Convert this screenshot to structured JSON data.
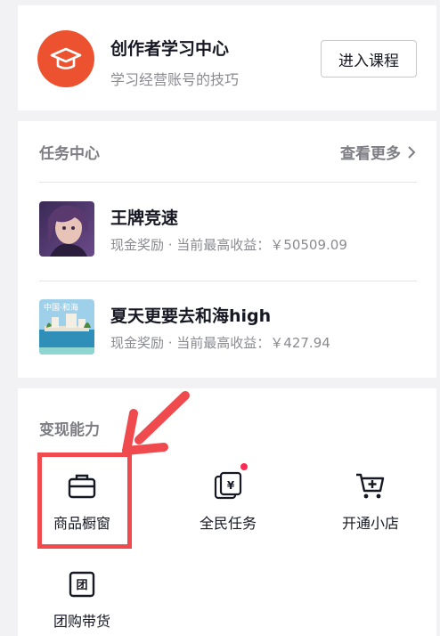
{
  "creator": {
    "title": "创作者学习中心",
    "subtitle": "学习经营账号的技巧",
    "button_label": "进入课程",
    "icon": "graduation-cap-icon",
    "accent": "#ec5230"
  },
  "tasks": {
    "title": "任务中心",
    "more_label": "查看更多",
    "items": [
      {
        "name": "王牌竞速",
        "desc": "现金奖励 · 当前最高收益：￥50509.09",
        "thumb": "game-portrait-thumbnail"
      },
      {
        "name": "夏天更要去和海high",
        "desc": "现金奖励 · 当前最高收益：￥427.94",
        "thumb": "seaside-thumbnail",
        "thumb_text": "中国·和海"
      }
    ]
  },
  "monetization": {
    "title": "变现能力",
    "features": [
      {
        "label": "商品橱窗",
        "icon": "shopping-bag-icon",
        "badge": false
      },
      {
        "label": "全民任务",
        "icon": "yen-coupon-icon",
        "badge": true
      },
      {
        "label": "开通小店",
        "icon": "cart-plus-icon",
        "badge": false
      },
      {
        "label": "团购带货",
        "icon": "group-buy-icon",
        "badge": false
      }
    ]
  },
  "annotation": {
    "color": "#ef4b4e"
  }
}
